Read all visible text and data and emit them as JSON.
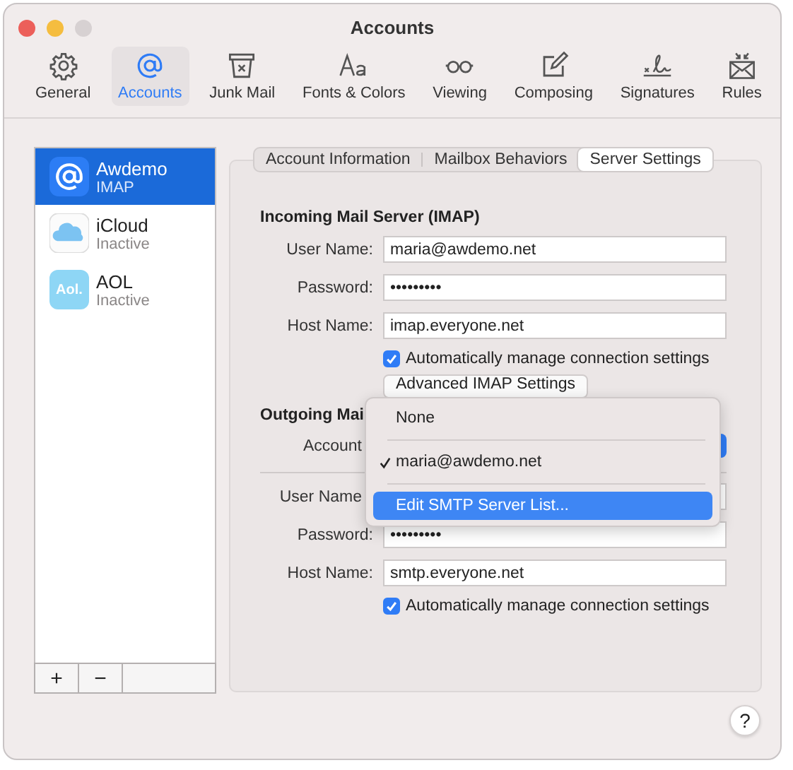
{
  "window": {
    "title": "Accounts"
  },
  "toolbar": [
    {
      "label": "General",
      "selected": false
    },
    {
      "label": "Accounts",
      "selected": true
    },
    {
      "label": "Junk Mail",
      "selected": false
    },
    {
      "label": "Fonts & Colors",
      "selected": false
    },
    {
      "label": "Viewing",
      "selected": false
    },
    {
      "label": "Composing",
      "selected": false
    },
    {
      "label": "Signatures",
      "selected": false
    },
    {
      "label": "Rules",
      "selected": false
    }
  ],
  "accounts": [
    {
      "name": "Awdemo",
      "status": "IMAP",
      "selected": true
    },
    {
      "name": "iCloud",
      "status": "Inactive",
      "selected": false
    },
    {
      "name": "AOL",
      "status": "Inactive",
      "selected": false,
      "badge": "Aol."
    }
  ],
  "list_buttons": [
    "+",
    "−"
  ],
  "tabs": [
    {
      "label": "Account Information",
      "selected": false
    },
    {
      "label": "Mailbox Behaviors",
      "selected": false
    },
    {
      "label": "Server Settings",
      "selected": true
    }
  ],
  "incoming": {
    "heading": "Incoming Mail Server (IMAP)",
    "fields": [
      {
        "label": "User Name:",
        "value": "maria@awdemo.net"
      },
      {
        "label": "Password:",
        "value": "•••••••••"
      },
      {
        "label": "Host Name:",
        "value": "imap.everyone.net"
      }
    ],
    "auto_manage": {
      "label": "Automatically manage connection settings",
      "checked": true
    },
    "advanced_button": "Advanced IMAP Settings"
  },
  "outgoing": {
    "heading": "Outgoing Mai",
    "account_label": "Account",
    "fields": [
      {
        "label": "User Name"
      },
      {
        "label": "Password:",
        "value": "•••••••••"
      },
      {
        "label": "Host Name:",
        "value": "smtp.everyone.net"
      }
    ],
    "auto_manage": {
      "label": "Automatically manage connection settings",
      "checked": true
    }
  },
  "menu": [
    {
      "label": "None",
      "checked": false,
      "selected": false
    },
    {
      "label": "maria@awdemo.net",
      "checked": true,
      "selected": false
    },
    {
      "label": "Edit SMTP Server List...",
      "checked": false,
      "selected": true
    }
  ],
  "help_button": "?"
}
